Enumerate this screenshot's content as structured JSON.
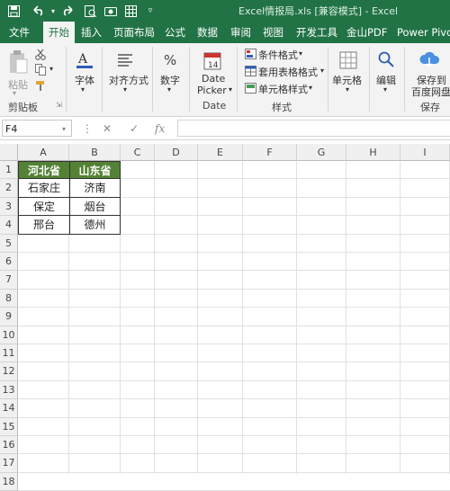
{
  "window": {
    "title": "Excel情报局.xls [兼容模式] - Excel"
  },
  "tabs": [
    {
      "label": "文件"
    },
    {
      "label": "开始"
    },
    {
      "label": "插入"
    },
    {
      "label": "页面布局"
    },
    {
      "label": "公式"
    },
    {
      "label": "数据"
    },
    {
      "label": "审阅"
    },
    {
      "label": "视图"
    },
    {
      "label": "开发工具"
    },
    {
      "label": "金山PDF"
    },
    {
      "label": "Power Pivot"
    }
  ],
  "ribbon": {
    "paste_label": "粘贴",
    "clipboard_group": "剪贴板",
    "font_label": "字体",
    "align_label": "对齐方式",
    "number_label": "数字",
    "datepicker_label1": "Date",
    "datepicker_label2": "Picker",
    "date_group": "Date",
    "cond_format": "条件格式",
    "table_format": "套用表格格式",
    "cell_style": "单元格样式",
    "style_group": "样式",
    "cells_label": "单元格",
    "edit_label": "编辑",
    "save_label1": "保存到",
    "save_label2": "百度网盘",
    "save_group": "保存"
  },
  "formula": {
    "namebox": "F4",
    "fx": "fx",
    "value": ""
  },
  "columns": [
    "A",
    "B",
    "C",
    "D",
    "E",
    "F",
    "G",
    "H",
    "I"
  ],
  "rows": [
    "1",
    "2",
    "3",
    "4",
    "5",
    "6",
    "7",
    "8",
    "9",
    "10",
    "11",
    "12",
    "13",
    "14",
    "15",
    "16",
    "17",
    "18"
  ],
  "table": {
    "headers": [
      "河北省",
      "山东省"
    ],
    "rows": [
      [
        "石家庄",
        "济南"
      ],
      [
        "保定",
        "烟台"
      ],
      [
        "邢台",
        "德州"
      ]
    ]
  },
  "colors": {
    "accent": "#217346",
    "header_fill": "#548235"
  },
  "icons": [
    "save-icon",
    "undo-icon",
    "redo-icon",
    "print-preview-icon",
    "camera-icon",
    "table-icon",
    "customize-icon",
    "paste-icon",
    "cut-icon",
    "copy-icon",
    "format-painter-icon",
    "font-icon",
    "align-icon",
    "percent-icon",
    "calendar-icon",
    "cond-format-icon",
    "table-format-icon",
    "cell-style-icon",
    "cells-icon",
    "search-icon",
    "cloud-save-icon",
    "cancel-icon",
    "enter-icon"
  ]
}
